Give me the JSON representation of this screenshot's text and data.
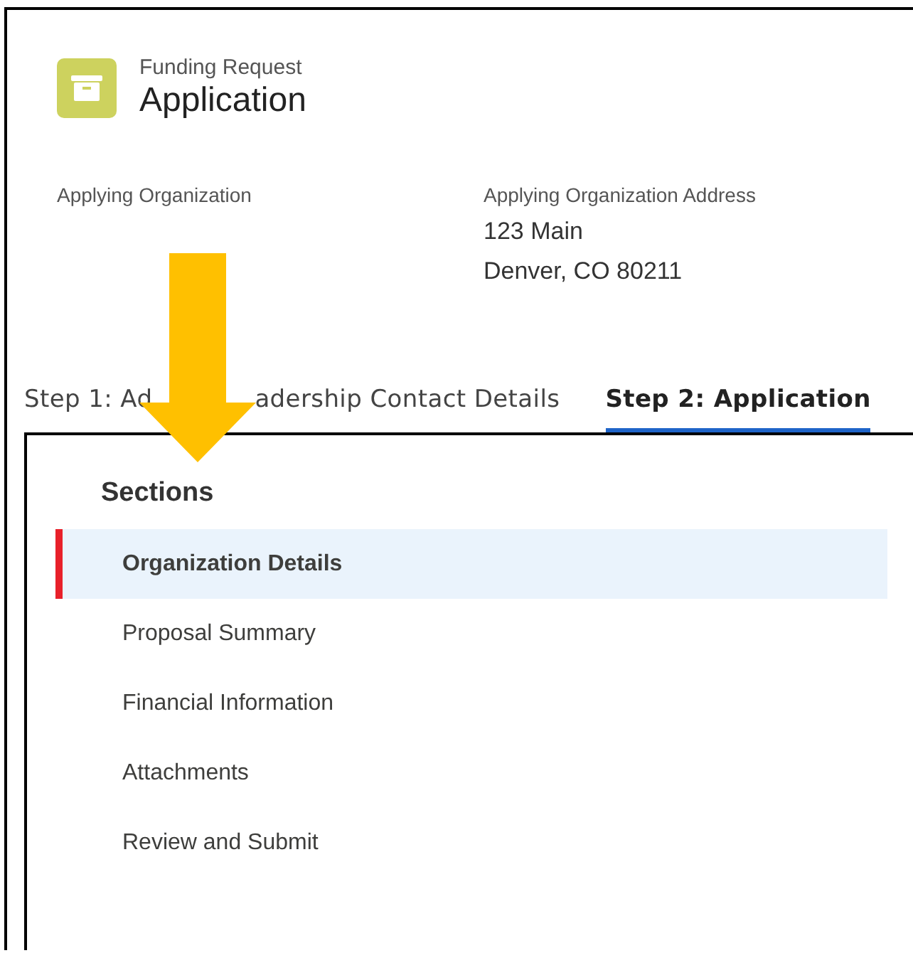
{
  "header": {
    "subtitle": "Funding Request",
    "title": "Application"
  },
  "fields": [
    {
      "label": "Applying Organization"
    },
    {
      "label": "Applying Organization Address",
      "lines": [
        "123 Main",
        "Denver, CO 80211"
      ]
    }
  ],
  "tabs": [
    {
      "label_start": "Step 1: Ad",
      "label_end": "adership Contact Details",
      "selected": false
    },
    {
      "label_start": "Step 2: Application",
      "selected": true
    }
  ],
  "sections": {
    "heading": "Sections",
    "items": [
      {
        "label": "Organization Details",
        "selected": true
      },
      {
        "label": "Proposal Summary",
        "selected": false
      },
      {
        "label": "Financial Information",
        "selected": false
      },
      {
        "label": "Attachments",
        "selected": false
      },
      {
        "label": "Review and Submit",
        "selected": false
      }
    ]
  }
}
